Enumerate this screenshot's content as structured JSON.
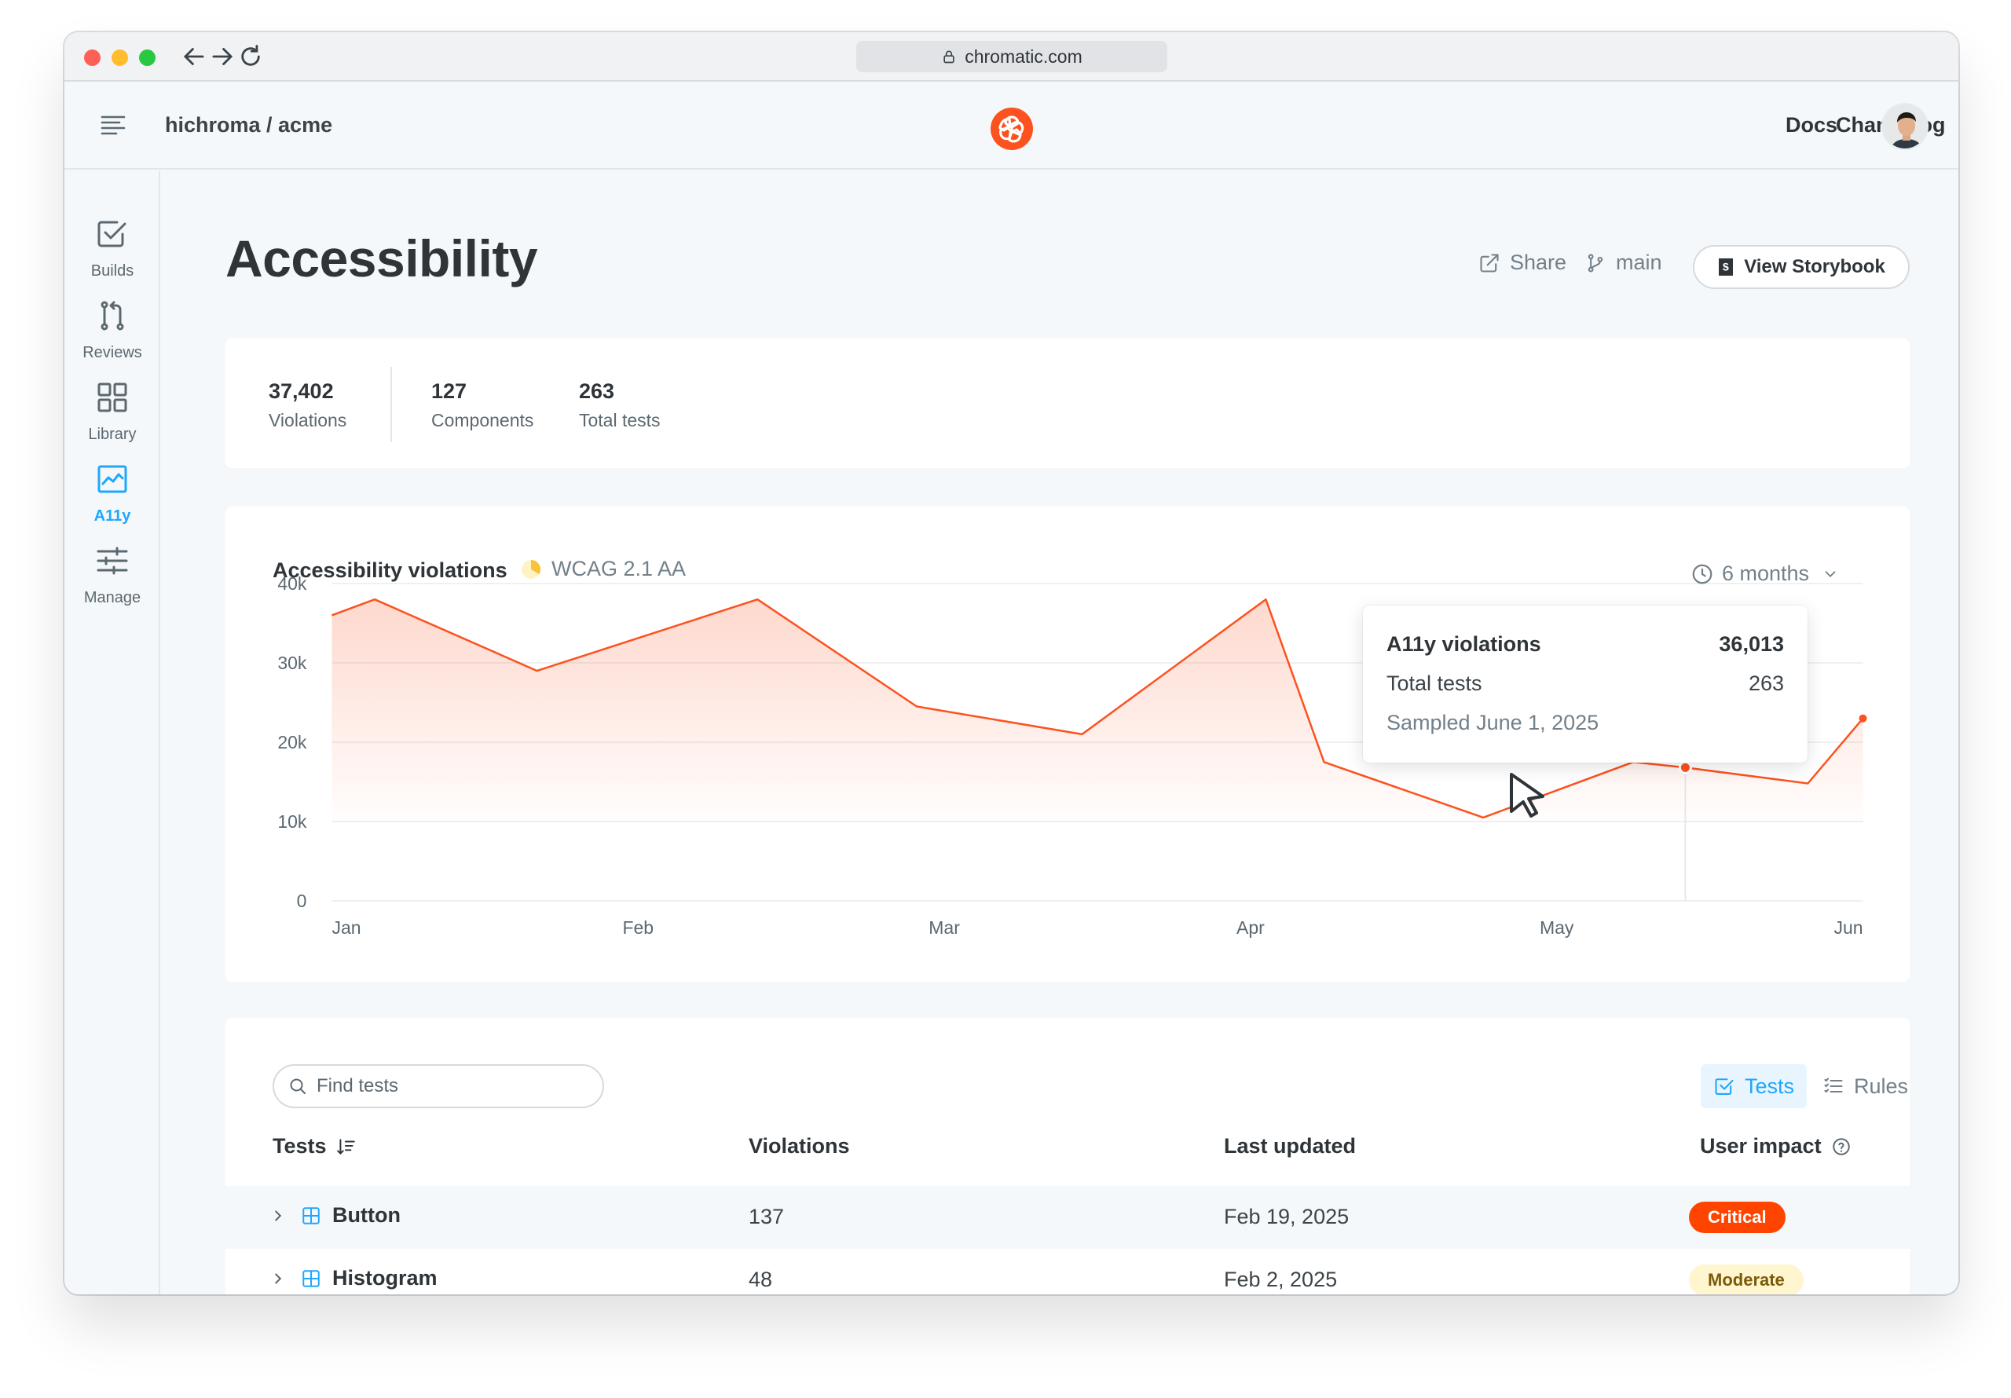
{
  "browser": {
    "url": "chromatic.com"
  },
  "header": {
    "breadcrumb": "hichroma / acme",
    "links": [
      "Docs",
      "Changelog"
    ]
  },
  "sidebar": {
    "items": [
      {
        "label": "Builds",
        "icon": "checkbox-icon",
        "active": false
      },
      {
        "label": "Reviews",
        "icon": "pull-request-icon",
        "active": false
      },
      {
        "label": "Library",
        "icon": "grid-icon",
        "active": false
      },
      {
        "label": "A11y",
        "icon": "chart-icon",
        "active": true
      },
      {
        "label": "Manage",
        "icon": "sliders-icon",
        "active": false
      }
    ]
  },
  "page": {
    "title": "Accessibility",
    "actions": {
      "share": "Share",
      "branch": "main",
      "storybook": "View Storybook"
    }
  },
  "stats": [
    {
      "value": "37,402",
      "label": "Violations"
    },
    {
      "value": "127",
      "label": "Components"
    },
    {
      "value": "263",
      "label": "Total tests"
    }
  ],
  "chart_section": {
    "title": "Accessibility violations",
    "standard": "WCAG 2.1 AA",
    "range": "6 months",
    "tooltip": {
      "label1": "A11y violations",
      "value1": "36,013",
      "label2": "Total tests",
      "value2": "263",
      "sampled": "Sampled June 1, 2025"
    }
  },
  "chart_data": {
    "type": "area",
    "x_ticks": [
      "Jan",
      "Feb",
      "Mar",
      "Apr",
      "May",
      "Jun"
    ],
    "y_ticks": [
      "0",
      "10k",
      "20k",
      "30k",
      "40k"
    ],
    "ylim": [
      0,
      40000
    ],
    "xlim": [
      0,
      5
    ],
    "points": [
      [
        0,
        36000
      ],
      [
        0.14,
        38000
      ],
      [
        0.67,
        29000
      ],
      [
        1.39,
        38000
      ],
      [
        1.91,
        24500
      ],
      [
        2.45,
        21000
      ],
      [
        3.05,
        38000
      ],
      [
        3.24,
        17500
      ],
      [
        3.76,
        10500
      ],
      [
        4.25,
        17500
      ],
      [
        4.42,
        16800
      ],
      [
        4.82,
        14800
      ],
      [
        5,
        23000
      ]
    ],
    "highlight_index": 10,
    "color": "#fc521f"
  },
  "table": {
    "search_placeholder": "Find tests",
    "toggle": {
      "tests": "Tests",
      "rules": "Rules"
    },
    "columns": [
      "Tests",
      "Violations",
      "Last updated",
      "User impact"
    ],
    "rows": [
      {
        "name": "Button",
        "violations": "137",
        "updated": "Feb 19, 2025",
        "impact": "Critical",
        "impact_bg": "#ff4400",
        "impact_fg": "#ffffff"
      },
      {
        "name": "Histogram",
        "violations": "48",
        "updated": "Feb 2, 2025",
        "impact": "Moderate",
        "impact_bg": "#fff5cf",
        "impact_fg": "#7a5b0a"
      }
    ]
  }
}
